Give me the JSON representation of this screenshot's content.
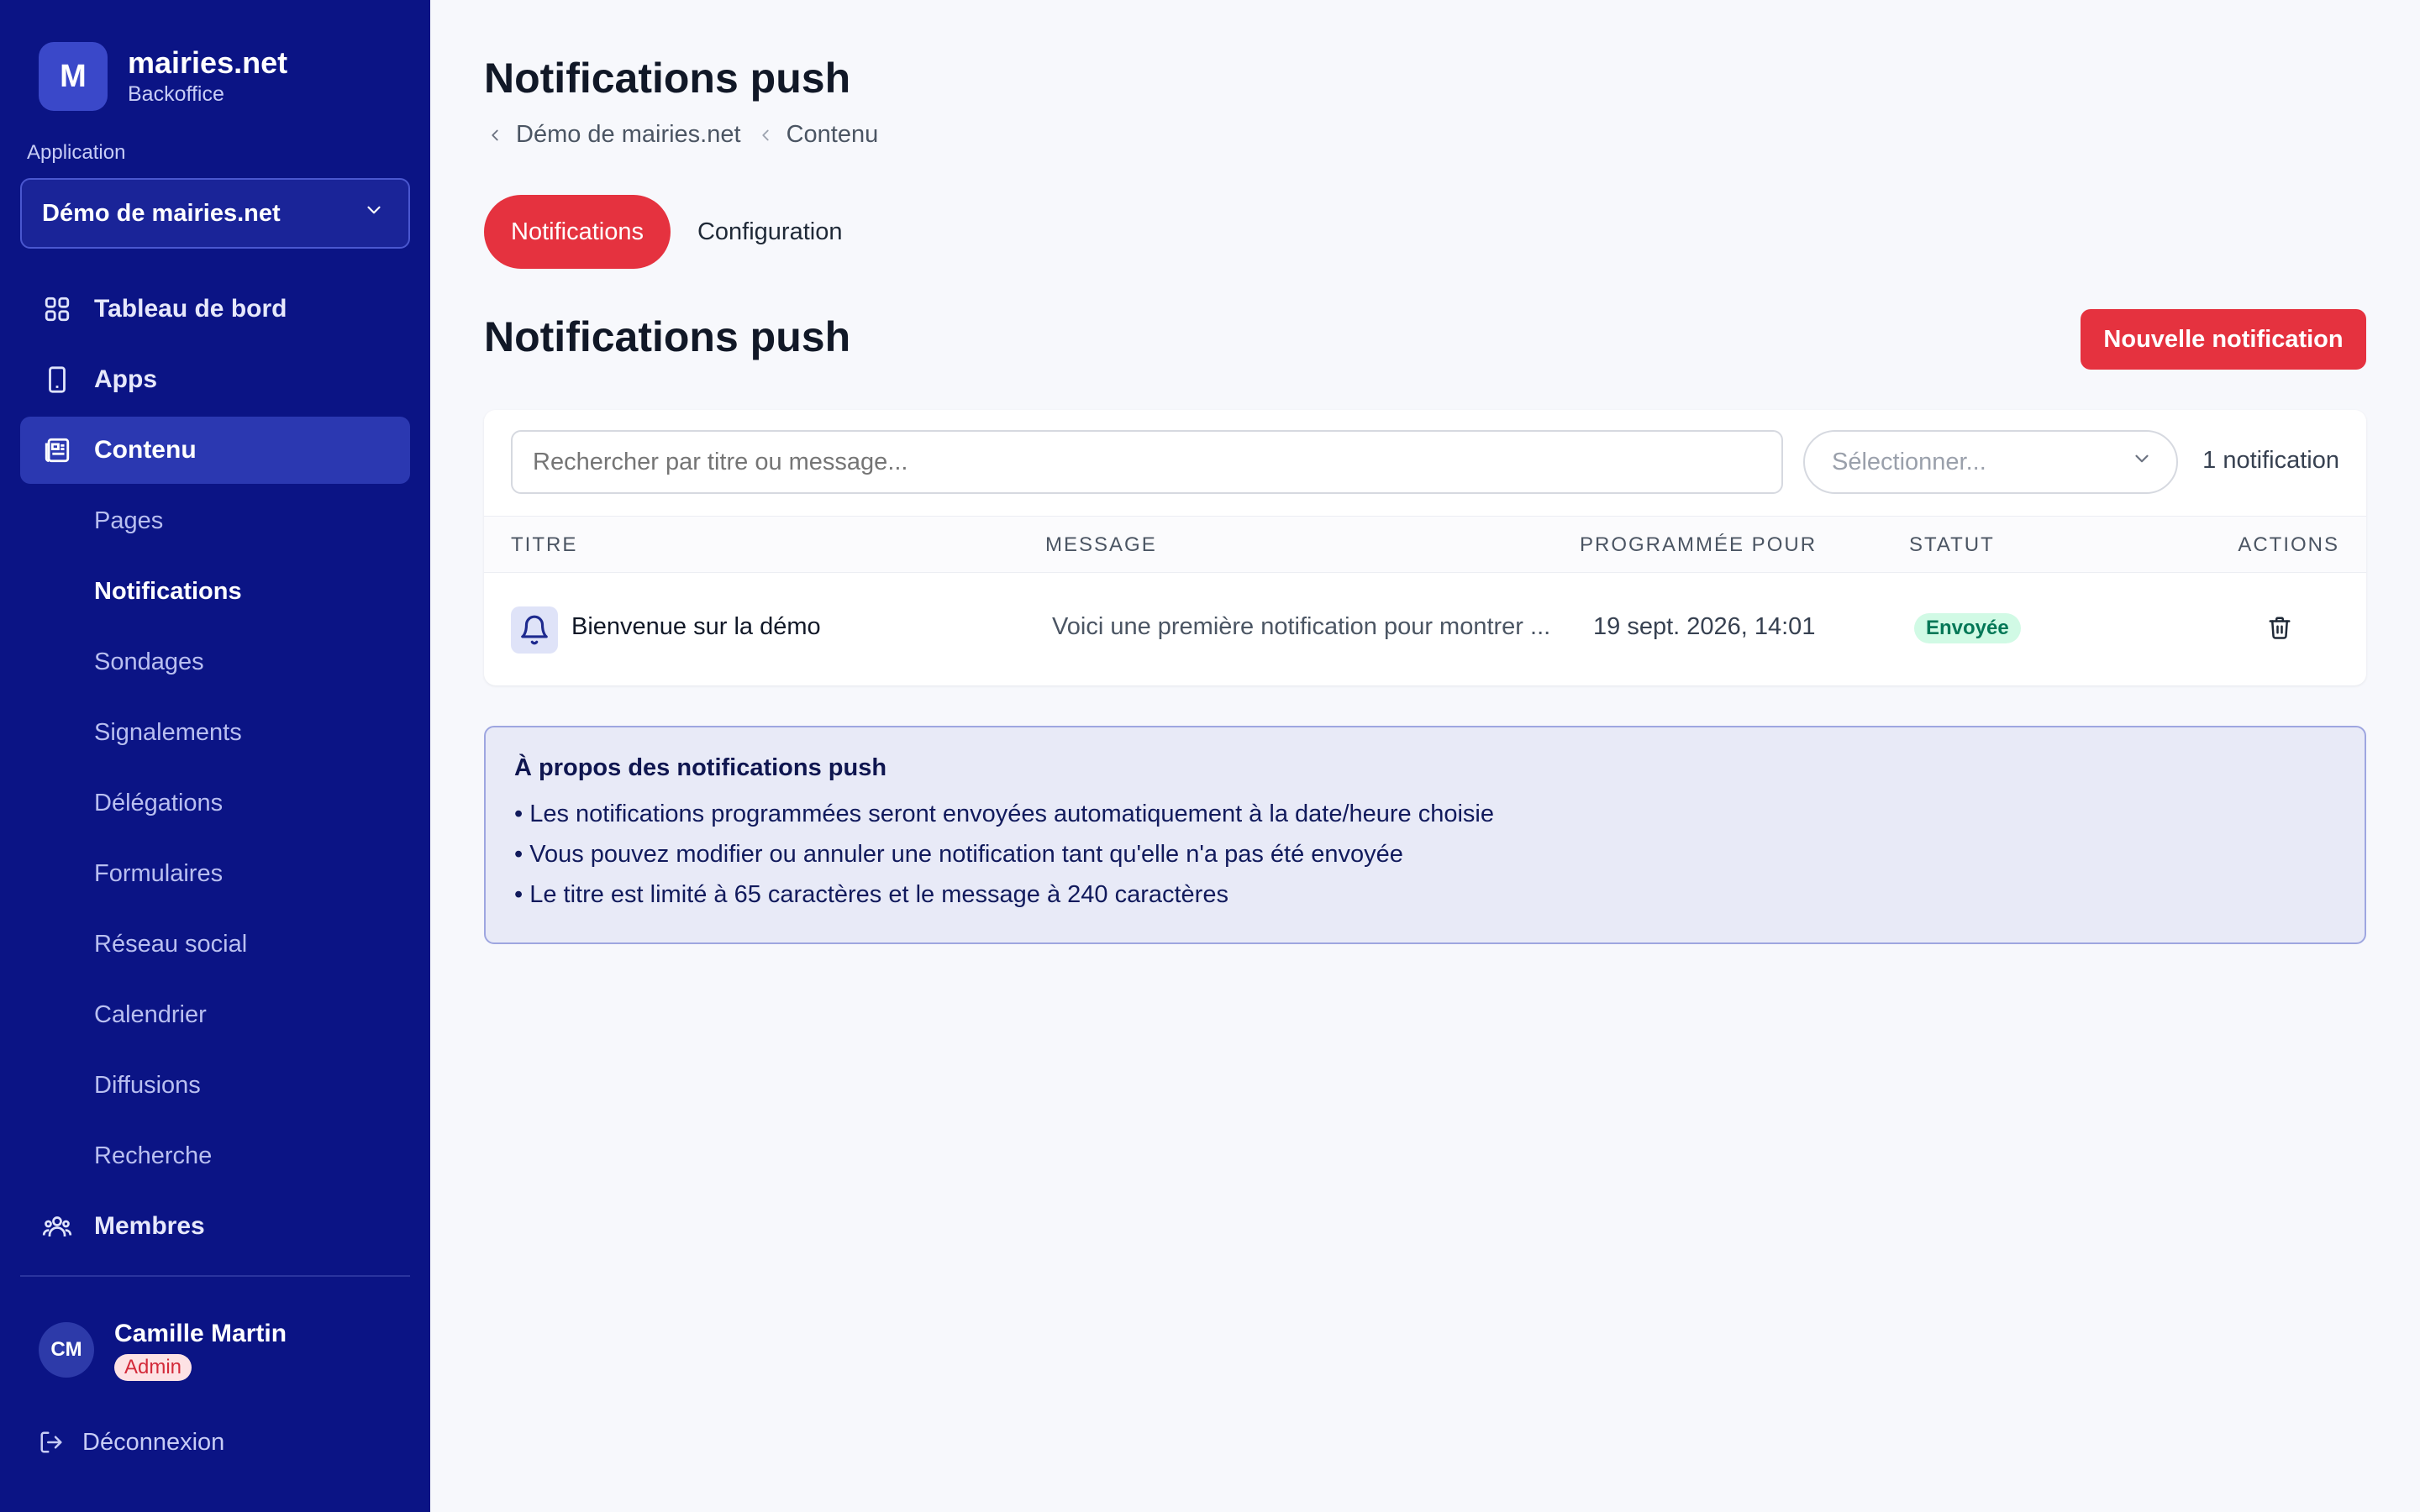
{
  "brand": {
    "logo_letter": "M",
    "name": "mairies.net",
    "subtitle": "Backoffice"
  },
  "sidebar": {
    "section_label": "Application",
    "app_select": {
      "value": "Démo de mairies.net"
    },
    "nav": {
      "dashboard": "Tableau de bord",
      "apps": "Apps",
      "content": "Contenu",
      "members": "Membres"
    },
    "sub_items": [
      "Pages",
      "Notifications",
      "Sondages",
      "Signalements",
      "Délégations",
      "Formulaires",
      "Réseau social",
      "Calendrier",
      "Diffusions",
      "Recherche"
    ],
    "active_sub_item": "Notifications",
    "user": {
      "initials": "CM",
      "name": "Camille Martin",
      "role": "Admin"
    },
    "logout_label": "Déconnexion"
  },
  "header": {
    "title": "Notifications push",
    "breadcrumb": [
      "Démo de mairies.net",
      "Contenu"
    ]
  },
  "tabs": [
    {
      "label": "Notifications",
      "active": true
    },
    {
      "label": "Configuration",
      "active": false
    }
  ],
  "section": {
    "title": "Notifications push",
    "new_button_label": "Nouvelle notification"
  },
  "filters": {
    "search_placeholder": "Rechercher par titre ou message...",
    "select_placeholder": "Sélectionner...",
    "count_label": "1 notification"
  },
  "table": {
    "columns": [
      "TITRE",
      "MESSAGE",
      "PROGRAMMÉE POUR",
      "STATUT",
      "ACTIONS"
    ],
    "rows": [
      {
        "title": "Bienvenue sur la démo",
        "message": "Voici une première notification pour montrer ...",
        "scheduled": "19 sept. 2026, 14:01",
        "status": "Envoyée"
      }
    ]
  },
  "info_box": {
    "title": "À propos des notifications push",
    "lines": [
      "Les notifications programmées seront envoyées automatiquement à la date/heure choisie",
      "Vous pouvez modifier ou annuler une notification tant qu'elle n'a pas été envoyée",
      "Le titre est limité à 65 caractères et le message à 240 caractères"
    ]
  },
  "colors": {
    "sidebar_bg": "#0b1485",
    "accent_red": "#e5323f",
    "status_sent_bg": "#d1fae5",
    "status_sent_text": "#047857"
  }
}
